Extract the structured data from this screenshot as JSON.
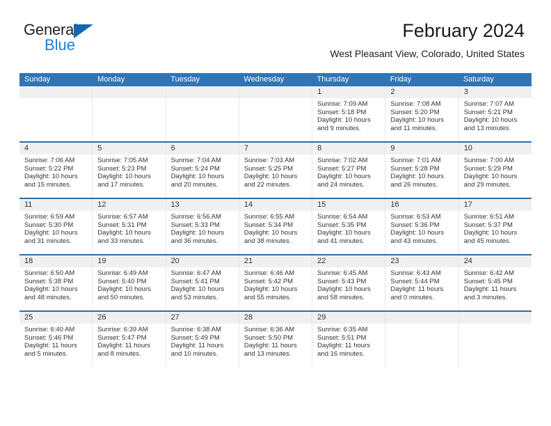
{
  "brand": {
    "name_top": "General",
    "name_bottom": "Blue",
    "accent_color": "#1167b1",
    "blue_text_color": "#1b7fd4"
  },
  "header": {
    "title": "February 2024",
    "subtitle": "West Pleasant View, Colorado, United States",
    "header_bg": "#3075b6",
    "header_text_color": "#ffffff",
    "daynum_bg": "#f0f0f0",
    "row_separator_color": "#2e6da8"
  },
  "weekdays": [
    "Sunday",
    "Monday",
    "Tuesday",
    "Wednesday",
    "Thursday",
    "Friday",
    "Saturday"
  ],
  "weeks": [
    [
      {
        "day": "",
        "lines": []
      },
      {
        "day": "",
        "lines": []
      },
      {
        "day": "",
        "lines": []
      },
      {
        "day": "",
        "lines": []
      },
      {
        "day": "1",
        "lines": [
          "Sunrise: 7:09 AM",
          "Sunset: 5:18 PM",
          "Daylight: 10 hours",
          "and 9 minutes."
        ]
      },
      {
        "day": "2",
        "lines": [
          "Sunrise: 7:08 AM",
          "Sunset: 5:20 PM",
          "Daylight: 10 hours",
          "and 11 minutes."
        ]
      },
      {
        "day": "3",
        "lines": [
          "Sunrise: 7:07 AM",
          "Sunset: 5:21 PM",
          "Daylight: 10 hours",
          "and 13 minutes."
        ]
      }
    ],
    [
      {
        "day": "4",
        "lines": [
          "Sunrise: 7:06 AM",
          "Sunset: 5:22 PM",
          "Daylight: 10 hours",
          "and 15 minutes."
        ]
      },
      {
        "day": "5",
        "lines": [
          "Sunrise: 7:05 AM",
          "Sunset: 5:23 PM",
          "Daylight: 10 hours",
          "and 17 minutes."
        ]
      },
      {
        "day": "6",
        "lines": [
          "Sunrise: 7:04 AM",
          "Sunset: 5:24 PM",
          "Daylight: 10 hours",
          "and 20 minutes."
        ]
      },
      {
        "day": "7",
        "lines": [
          "Sunrise: 7:03 AM",
          "Sunset: 5:25 PM",
          "Daylight: 10 hours",
          "and 22 minutes."
        ]
      },
      {
        "day": "8",
        "lines": [
          "Sunrise: 7:02 AM",
          "Sunset: 5:27 PM",
          "Daylight: 10 hours",
          "and 24 minutes."
        ]
      },
      {
        "day": "9",
        "lines": [
          "Sunrise: 7:01 AM",
          "Sunset: 5:28 PM",
          "Daylight: 10 hours",
          "and 26 minutes."
        ]
      },
      {
        "day": "10",
        "lines": [
          "Sunrise: 7:00 AM",
          "Sunset: 5:29 PM",
          "Daylight: 10 hours",
          "and 29 minutes."
        ]
      }
    ],
    [
      {
        "day": "11",
        "lines": [
          "Sunrise: 6:59 AM",
          "Sunset: 5:30 PM",
          "Daylight: 10 hours",
          "and 31 minutes."
        ]
      },
      {
        "day": "12",
        "lines": [
          "Sunrise: 6:57 AM",
          "Sunset: 5:31 PM",
          "Daylight: 10 hours",
          "and 33 minutes."
        ]
      },
      {
        "day": "13",
        "lines": [
          "Sunrise: 6:56 AM",
          "Sunset: 5:33 PM",
          "Daylight: 10 hours",
          "and 36 minutes."
        ]
      },
      {
        "day": "14",
        "lines": [
          "Sunrise: 6:55 AM",
          "Sunset: 5:34 PM",
          "Daylight: 10 hours",
          "and 38 minutes."
        ]
      },
      {
        "day": "15",
        "lines": [
          "Sunrise: 6:54 AM",
          "Sunset: 5:35 PM",
          "Daylight: 10 hours",
          "and 41 minutes."
        ]
      },
      {
        "day": "16",
        "lines": [
          "Sunrise: 6:53 AM",
          "Sunset: 5:36 PM",
          "Daylight: 10 hours",
          "and 43 minutes."
        ]
      },
      {
        "day": "17",
        "lines": [
          "Sunrise: 6:51 AM",
          "Sunset: 5:37 PM",
          "Daylight: 10 hours",
          "and 45 minutes."
        ]
      }
    ],
    [
      {
        "day": "18",
        "lines": [
          "Sunrise: 6:50 AM",
          "Sunset: 5:38 PM",
          "Daylight: 10 hours",
          "and 48 minutes."
        ]
      },
      {
        "day": "19",
        "lines": [
          "Sunrise: 6:49 AM",
          "Sunset: 5:40 PM",
          "Daylight: 10 hours",
          "and 50 minutes."
        ]
      },
      {
        "day": "20",
        "lines": [
          "Sunrise: 6:47 AM",
          "Sunset: 5:41 PM",
          "Daylight: 10 hours",
          "and 53 minutes."
        ]
      },
      {
        "day": "21",
        "lines": [
          "Sunrise: 6:46 AM",
          "Sunset: 5:42 PM",
          "Daylight: 10 hours",
          "and 55 minutes."
        ]
      },
      {
        "day": "22",
        "lines": [
          "Sunrise: 6:45 AM",
          "Sunset: 5:43 PM",
          "Daylight: 10 hours",
          "and 58 minutes."
        ]
      },
      {
        "day": "23",
        "lines": [
          "Sunrise: 6:43 AM",
          "Sunset: 5:44 PM",
          "Daylight: 11 hours",
          "and 0 minutes."
        ]
      },
      {
        "day": "24",
        "lines": [
          "Sunrise: 6:42 AM",
          "Sunset: 5:45 PM",
          "Daylight: 11 hours",
          "and 3 minutes."
        ]
      }
    ],
    [
      {
        "day": "25",
        "lines": [
          "Sunrise: 6:40 AM",
          "Sunset: 5:46 PM",
          "Daylight: 11 hours",
          "and 5 minutes."
        ]
      },
      {
        "day": "26",
        "lines": [
          "Sunrise: 6:39 AM",
          "Sunset: 5:47 PM",
          "Daylight: 11 hours",
          "and 8 minutes."
        ]
      },
      {
        "day": "27",
        "lines": [
          "Sunrise: 6:38 AM",
          "Sunset: 5:49 PM",
          "Daylight: 11 hours",
          "and 10 minutes."
        ]
      },
      {
        "day": "28",
        "lines": [
          "Sunrise: 6:36 AM",
          "Sunset: 5:50 PM",
          "Daylight: 11 hours",
          "and 13 minutes."
        ]
      },
      {
        "day": "29",
        "lines": [
          "Sunrise: 6:35 AM",
          "Sunset: 5:51 PM",
          "Daylight: 11 hours",
          "and 16 minutes."
        ]
      },
      {
        "day": "",
        "lines": []
      },
      {
        "day": "",
        "lines": []
      }
    ]
  ]
}
